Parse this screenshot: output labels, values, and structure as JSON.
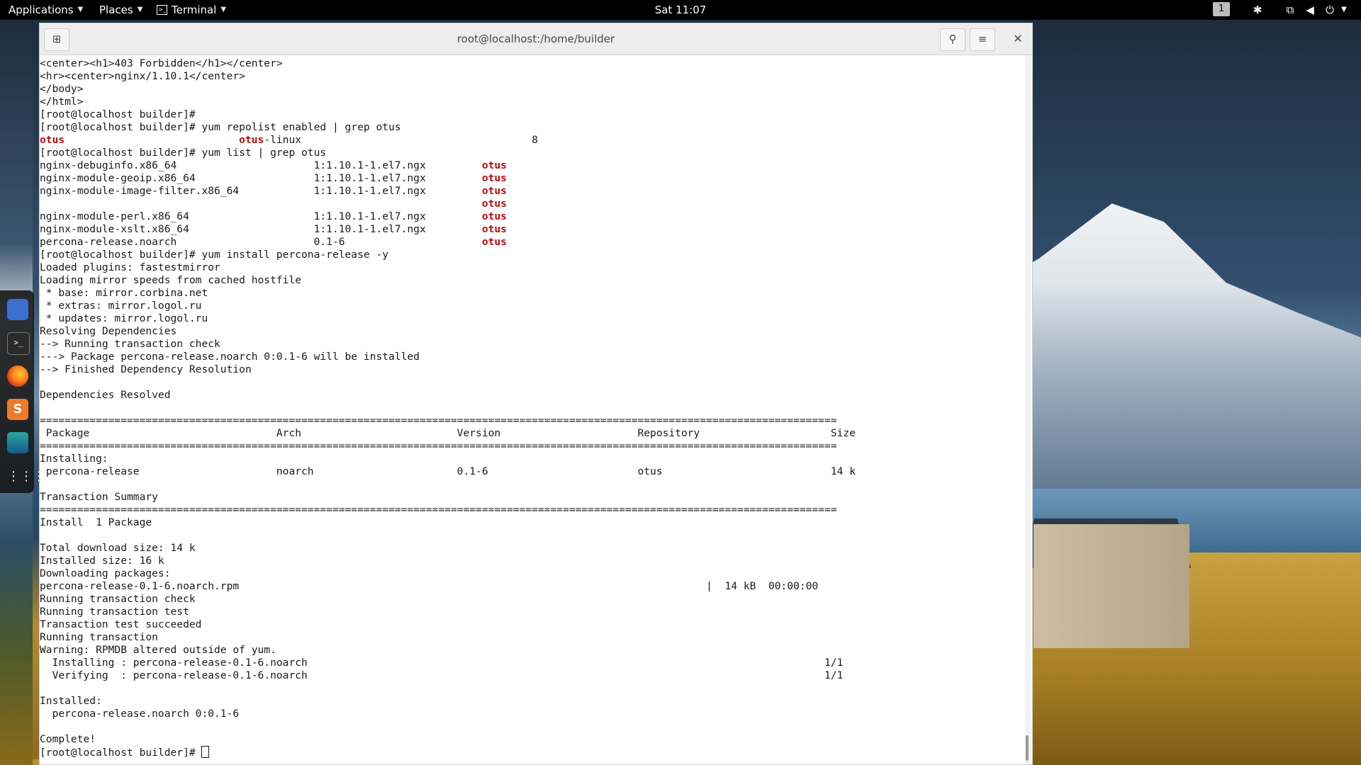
{
  "topbar": {
    "applications": "Applications",
    "places": "Places",
    "terminal": "Terminal",
    "clock": "Sat 11:07",
    "workspace": "1",
    "icons": [
      "accessibility-icon",
      "network-icon",
      "volume-icon",
      "power-icon"
    ]
  },
  "dock": {
    "apps": [
      "text-editor-icon",
      "terminal-icon",
      "firefox-icon",
      "sublime-icon",
      "avatar-app-icon",
      "app-grid-icon"
    ]
  },
  "window": {
    "title": "root@localhost:/home/builder",
    "buttons": [
      "new-tab-icon",
      "search-icon",
      "menu-icon",
      "close-icon"
    ]
  },
  "terminal": {
    "lines": [
      {
        "segments": [
          {
            "t": "<center><h1>403 Forbidden</h1></center>"
          }
        ]
      },
      {
        "segments": [
          {
            "t": "<hr><center>nginx/1.10.1</center>"
          }
        ]
      },
      {
        "segments": [
          {
            "t": "</body>"
          }
        ]
      },
      {
        "segments": [
          {
            "t": "</html>"
          }
        ]
      },
      {
        "segments": [
          {
            "t": "[root@localhost builder]#"
          }
        ]
      },
      {
        "segments": [
          {
            "t": "[root@localhost builder]# yum repolist enabled | grep otus"
          }
        ]
      },
      {
        "segments": [
          {
            "t": "otus",
            "red": true
          },
          {
            "t": "                            "
          },
          {
            "t": "otus",
            "red": true
          },
          {
            "t": "-linux                                     8"
          }
        ]
      },
      {
        "segments": [
          {
            "t": "[root@localhost builder]# yum list | grep otus"
          }
        ]
      },
      {
        "segments": [
          {
            "t": "nginx-debuginfo.x86_64                      1:1.10.1-1.el7.ngx         "
          },
          {
            "t": "otus",
            "red": true
          }
        ]
      },
      {
        "segments": [
          {
            "t": "nginx-module-geoip.x86_64                   1:1.10.1-1.el7.ngx         "
          },
          {
            "t": "otus",
            "red": true
          }
        ]
      },
      {
        "segments": [
          {
            "t": "nginx-module-image-filter.x86_64            1:1.10.1-1.el7.ngx         "
          },
          {
            "t": "otus",
            "red": true
          }
        ]
      },
      {
        "segments": [
          {
            "t": "                                                                       "
          },
          {
            "t": "otus",
            "red": true
          }
        ]
      },
      {
        "segments": [
          {
            "t": "nginx-module-perl.x86_64                    1:1.10.1-1.el7.ngx         "
          },
          {
            "t": "otus",
            "red": true
          }
        ]
      },
      {
        "segments": [
          {
            "t": "nginx-module-xslt.x86_64                    1:1.10.1-1.el7.ngx         "
          },
          {
            "t": "otus",
            "red": true
          }
        ]
      },
      {
        "segments": [
          {
            "t": "percona-release.noarch                      0.1-6                      "
          },
          {
            "t": "otus",
            "red": true
          }
        ]
      },
      {
        "segments": [
          {
            "t": "[root@localhost builder]# yum install percona-release -y"
          }
        ]
      },
      {
        "segments": [
          {
            "t": "Loaded plugins: fastestmirror"
          }
        ]
      },
      {
        "segments": [
          {
            "t": "Loading mirror speeds from cached hostfile"
          }
        ]
      },
      {
        "segments": [
          {
            "t": " * base: mirror.corbina.net"
          }
        ]
      },
      {
        "segments": [
          {
            "t": " * extras: mirror.logol.ru"
          }
        ]
      },
      {
        "segments": [
          {
            "t": " * updates: mirror.logol.ru"
          }
        ]
      },
      {
        "segments": [
          {
            "t": "Resolving Dependencies"
          }
        ]
      },
      {
        "segments": [
          {
            "t": "--> Running transaction check"
          }
        ]
      },
      {
        "segments": [
          {
            "t": "---> Package percona-release.noarch 0:0.1-6 will be installed"
          }
        ]
      },
      {
        "segments": [
          {
            "t": "--> Finished Dependency Resolution"
          }
        ]
      },
      {
        "segments": [
          {
            "t": ""
          }
        ]
      },
      {
        "segments": [
          {
            "t": "Dependencies Resolved"
          }
        ]
      },
      {
        "segments": [
          {
            "t": ""
          }
        ]
      },
      {
        "segments": [
          {
            "t": "================================================================================================================================"
          }
        ]
      },
      {
        "segments": [
          {
            "t": " Package                              Arch                         Version                      Repository                     Size"
          }
        ]
      },
      {
        "segments": [
          {
            "t": "================================================================================================================================"
          }
        ]
      },
      {
        "segments": [
          {
            "t": "Installing:"
          }
        ]
      },
      {
        "segments": [
          {
            "t": " percona-release                      noarch                       0.1-6                        otus                           14 k"
          }
        ]
      },
      {
        "segments": [
          {
            "t": ""
          }
        ]
      },
      {
        "segments": [
          {
            "t": "Transaction Summary"
          }
        ]
      },
      {
        "segments": [
          {
            "t": "================================================================================================================================"
          }
        ]
      },
      {
        "segments": [
          {
            "t": "Install  1 Package"
          }
        ]
      },
      {
        "segments": [
          {
            "t": ""
          }
        ]
      },
      {
        "segments": [
          {
            "t": "Total download size: 14 k"
          }
        ]
      },
      {
        "segments": [
          {
            "t": "Installed size: 16 k"
          }
        ]
      },
      {
        "segments": [
          {
            "t": "Downloading packages:"
          }
        ]
      },
      {
        "segments": [
          {
            "t": "percona-release-0.1-6.noarch.rpm                                                                           |  14 kB  00:00:00"
          }
        ]
      },
      {
        "segments": [
          {
            "t": "Running transaction check"
          }
        ]
      },
      {
        "segments": [
          {
            "t": "Running transaction test"
          }
        ]
      },
      {
        "segments": [
          {
            "t": "Transaction test succeeded"
          }
        ]
      },
      {
        "segments": [
          {
            "t": "Running transaction"
          }
        ]
      },
      {
        "segments": [
          {
            "t": "Warning: RPMDB altered outside of yum."
          }
        ]
      },
      {
        "segments": [
          {
            "t": "  Installing : percona-release-0.1-6.noarch                                                                                   1/1"
          }
        ]
      },
      {
        "segments": [
          {
            "t": "  Verifying  : percona-release-0.1-6.noarch                                                                                   1/1"
          }
        ]
      },
      {
        "segments": [
          {
            "t": ""
          }
        ]
      },
      {
        "segments": [
          {
            "t": "Installed:"
          }
        ]
      },
      {
        "segments": [
          {
            "t": "  percona-release.noarch 0:0.1-6"
          }
        ]
      },
      {
        "segments": [
          {
            "t": ""
          }
        ]
      },
      {
        "segments": [
          {
            "t": "Complete!"
          }
        ]
      },
      {
        "segments": [
          {
            "t": "[root@localhost builder]# "
          }
        ],
        "cursor": true
      }
    ]
  }
}
